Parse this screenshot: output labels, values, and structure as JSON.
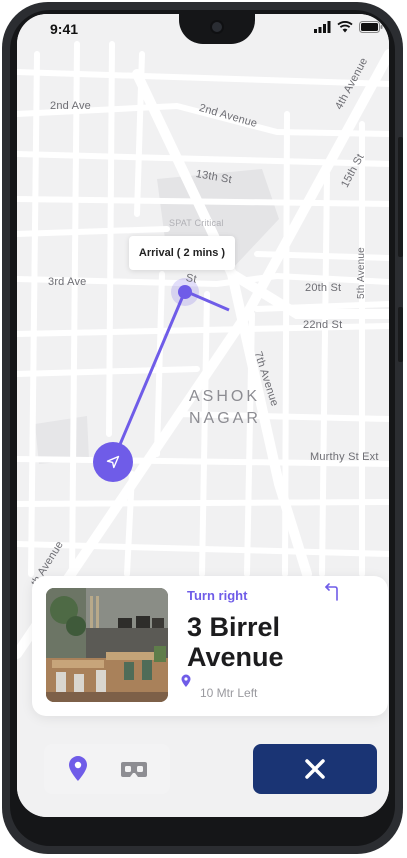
{
  "status_bar": {
    "time": "9:41"
  },
  "map": {
    "street_labels": {
      "second_ave": "2nd Ave",
      "second_avenue": "2nd Avenue",
      "thirteenth_st": "13th St",
      "fourth_avenue": "4th Avenue",
      "fifteenth_st": "15th St",
      "third_ave": "3rd Ave",
      "fifth_avenue": "5th Avenue",
      "twentieth_st": "20th St",
      "twentysecond_st": "22nd St",
      "seventh_avenue": "7th Avenue",
      "murthy_st_ext": "Murthy St Ext",
      "avenue_bottom": "th Avenue",
      "faded_label": "SPAT Critical",
      "st_partial": "St"
    },
    "area_name_line1": "ASHOK",
    "area_name_line2": "NAGAR",
    "arrival_tooltip": "Arrival ( 2 mins )",
    "route_color": "#6f5ce8"
  },
  "direction_card": {
    "instruction": "Turn right",
    "street_name": "3 Birrel Avenue",
    "distance": "10 Mtr Left",
    "instruction_icon": "turn-right-arrow-icon"
  },
  "bottom_bar": {
    "location_icon": "location-pin-icon",
    "vr_icon": "vr-headset-icon",
    "close_icon": "close-icon"
  },
  "colors": {
    "accent": "#6f5ce8",
    "close_button": "#1a3474",
    "map_background": "#f1f1f2"
  }
}
